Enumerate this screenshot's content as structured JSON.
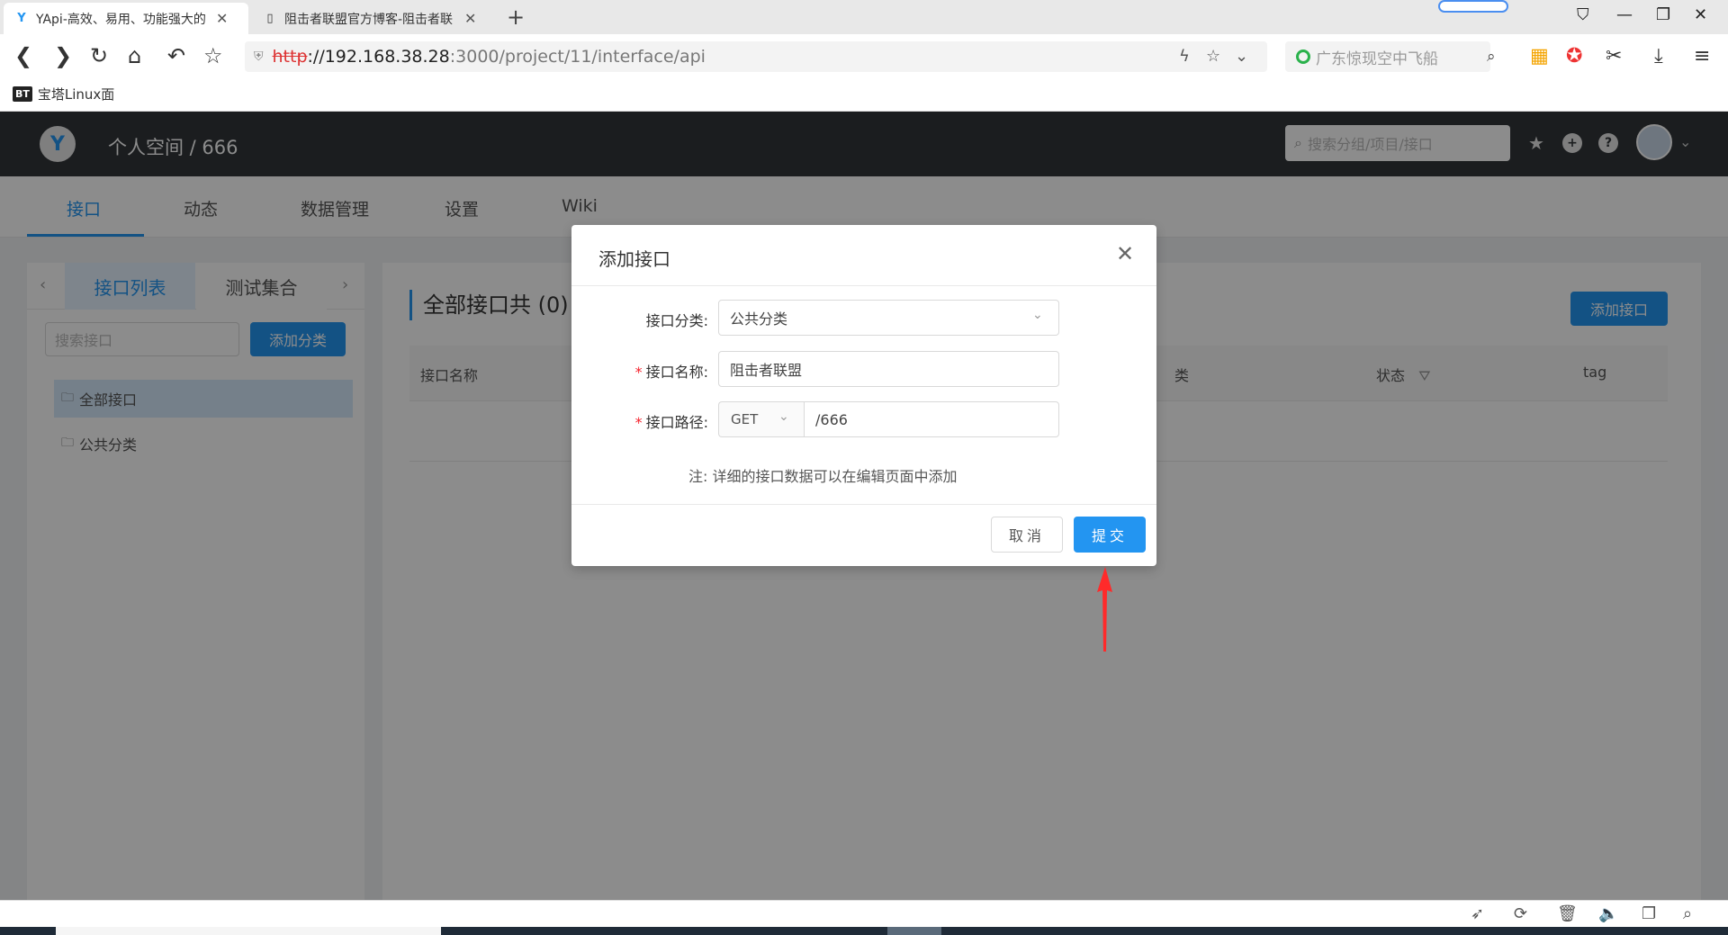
{
  "browser": {
    "tabs": [
      {
        "title": "YApi-高效、易用、功能强大的",
        "active": true
      },
      {
        "title": "阻击者联盟官方博客-阻击者联",
        "active": false
      }
    ],
    "url": {
      "scheme": "http",
      "host": "://192.168.38.28",
      "rest": ":3000/project/11/interface/api"
    },
    "search_placeholder": "广东惊现空中飞船",
    "bookmark": {
      "badge": "BT",
      "label": "宝塔Linux面"
    }
  },
  "app": {
    "breadcrumb": "个人空间  /  666",
    "global_search_placeholder": "搜索分组/项目/接口",
    "subnav": [
      "接口",
      "动态",
      "数据管理",
      "设置",
      "Wiki"
    ],
    "left": {
      "tabs": [
        "接口列表",
        "测试集合"
      ],
      "search_placeholder": "搜索接口",
      "add_category": "添加分类",
      "tree": [
        "全部接口",
        "公共分类"
      ]
    },
    "main": {
      "title": "全部接口共 (0) 个",
      "add_interface": "添加接口",
      "columns": [
        "接口名称",
        "类",
        "状态",
        "tag"
      ]
    }
  },
  "modal": {
    "title": "添加接口",
    "fields": {
      "category_label": "接口分类:",
      "category_value": "公共分类",
      "name_label": "接口名称:",
      "name_value": "阻击者联盟",
      "path_label": "接口路径:",
      "method": "GET",
      "path_value": "/666"
    },
    "note": "注:  详细的接口数据可以在编辑页面中添加",
    "cancel": "取消",
    "submit": "提交"
  },
  "colors": {
    "primary": "#2395f1",
    "topnav": "#32363a",
    "required": "#f5222d",
    "annotation": "#ff2a2a"
  }
}
